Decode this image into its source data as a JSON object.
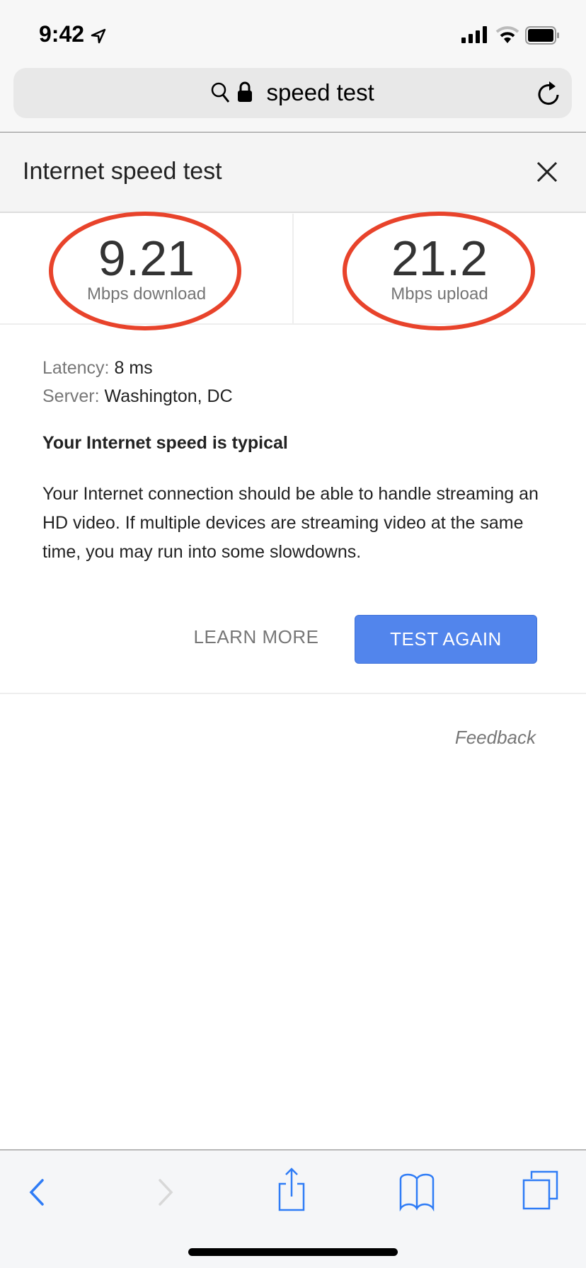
{
  "status_bar": {
    "time": "9:42",
    "icons": [
      "location-arrow-icon",
      "signal-icon",
      "wifi-icon",
      "battery-icon"
    ]
  },
  "browser": {
    "url_text": "speed test",
    "icons": [
      "search-icon",
      "lock-icon",
      "reload-icon"
    ]
  },
  "card": {
    "title": "Internet speed test",
    "download": {
      "value": "9.21",
      "unit": "Mbps download"
    },
    "upload": {
      "value": "21.2",
      "unit": "Mbps upload"
    },
    "latency_label": "Latency:",
    "latency_value": "8 ms",
    "server_label": "Server:",
    "server_value": "Washington, DC",
    "heading": "Your Internet speed is typical",
    "description": "Your Internet connection should be able to handle streaming an HD video. If multiple devices are streaming video at the same time, you may run into some slowdowns.",
    "learn_more": "LEARN MORE",
    "test_again": "TEST AGAIN",
    "feedback": "Feedback"
  },
  "colors": {
    "accent": "#5285ec",
    "annotation": "#e8432b",
    "toolbar_icon": "#2f7cf6"
  },
  "toolbar": {
    "icons": [
      "back-icon",
      "forward-icon",
      "share-icon",
      "bookmarks-icon",
      "tabs-icon"
    ]
  }
}
